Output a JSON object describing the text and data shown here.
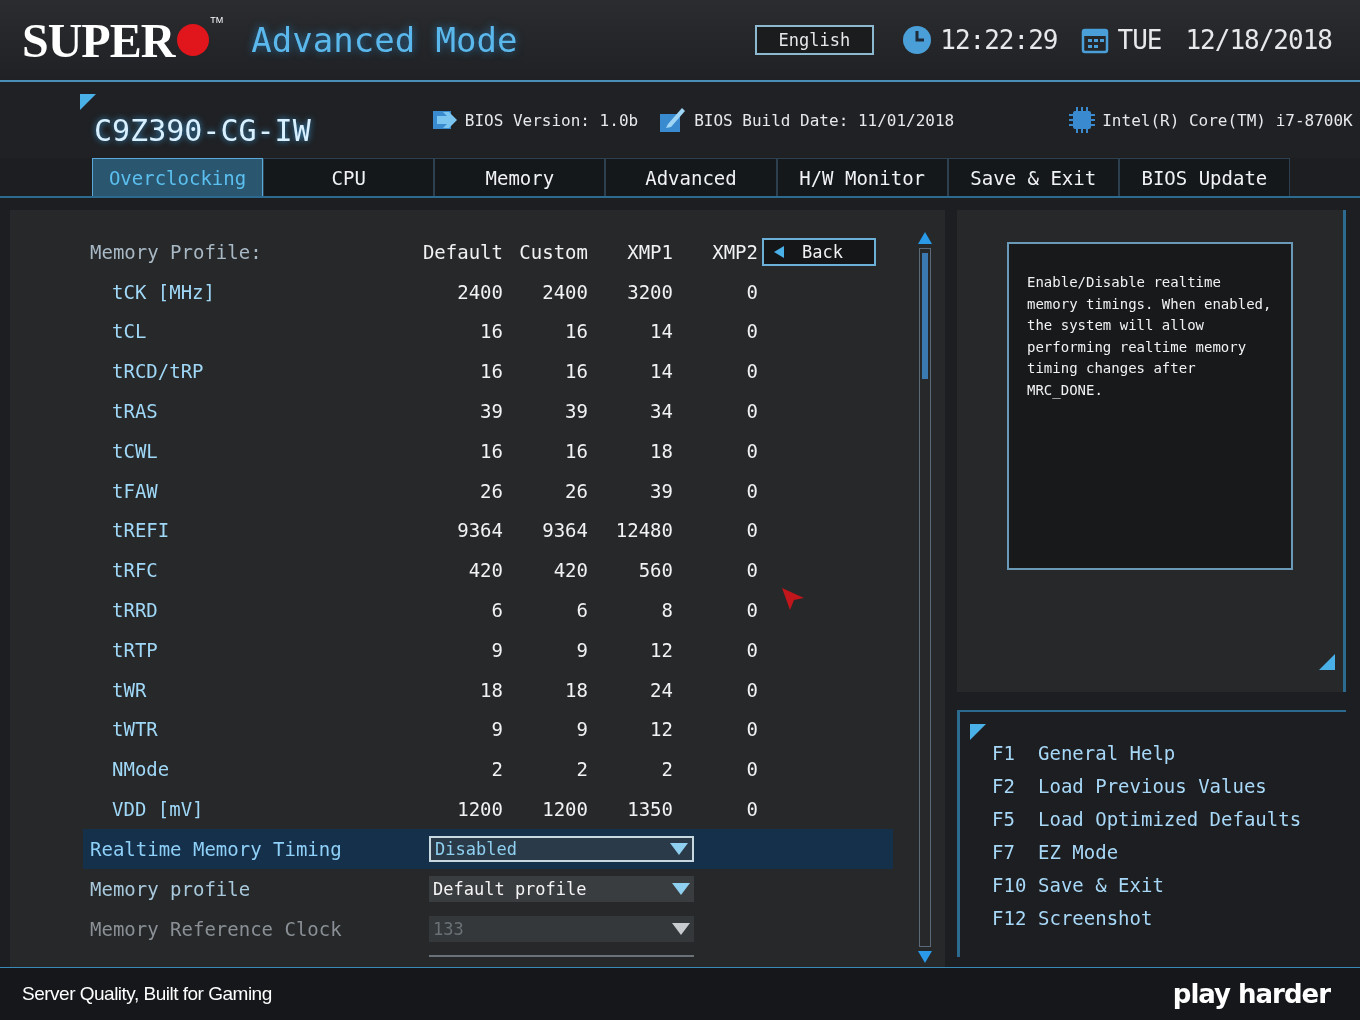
{
  "header": {
    "logo": "SUPER",
    "trademark": "TM",
    "mode_title": "Advanced Mode",
    "language": "English",
    "time": "12:22:29",
    "day": "TUE",
    "date": "12/18/2018"
  },
  "info_bar": {
    "board": "C9Z390-CG-IW",
    "bios_version": "BIOS Version: 1.0b",
    "build_date": "BIOS Build Date: 11/01/2018",
    "cpu": "Intel(R) Core(TM) i7-8700K"
  },
  "tabs": [
    {
      "label": "Overclocking",
      "selected": true
    },
    {
      "label": "CPU",
      "selected": false
    },
    {
      "label": "Memory",
      "selected": false
    },
    {
      "label": "Advanced",
      "selected": false
    },
    {
      "label": "H/W Monitor",
      "selected": false
    },
    {
      "label": "Save & Exit",
      "selected": false
    },
    {
      "label": "BIOS Update",
      "selected": false
    }
  ],
  "memory_table": {
    "columns": [
      "Memory Profile:",
      "Default",
      "Custom",
      "XMP1",
      "XMP2"
    ],
    "back_button": "Back",
    "rows": [
      {
        "label": "tCK [MHz]",
        "values": [
          "2400",
          "2400",
          "3200",
          "0"
        ]
      },
      {
        "label": "tCL",
        "values": [
          "16",
          "16",
          "14",
          "0"
        ]
      },
      {
        "label": "tRCD/tRP",
        "values": [
          "16",
          "16",
          "14",
          "0"
        ]
      },
      {
        "label": "tRAS",
        "values": [
          "39",
          "39",
          "34",
          "0"
        ]
      },
      {
        "label": "tCWL",
        "values": [
          "16",
          "16",
          "18",
          "0"
        ]
      },
      {
        "label": "tFAW",
        "values": [
          "26",
          "26",
          "39",
          "0"
        ]
      },
      {
        "label": "tREFI",
        "values": [
          "9364",
          "9364",
          "12480",
          "0"
        ]
      },
      {
        "label": "tRFC",
        "values": [
          "420",
          "420",
          "560",
          "0"
        ]
      },
      {
        "label": "tRRD",
        "values": [
          "6",
          "6",
          "8",
          "0"
        ]
      },
      {
        "label": "tRTP",
        "values": [
          "9",
          "9",
          "12",
          "0"
        ]
      },
      {
        "label": "tWR",
        "values": [
          "18",
          "18",
          "24",
          "0"
        ]
      },
      {
        "label": "tWTR",
        "values": [
          "9",
          "9",
          "12",
          "0"
        ]
      },
      {
        "label": "NMode",
        "values": [
          "2",
          "2",
          "2",
          "0"
        ]
      },
      {
        "label": "VDD [mV]",
        "values": [
          "1200",
          "1200",
          "1350",
          "0"
        ]
      }
    ]
  },
  "settings": [
    {
      "label": "Realtime Memory Timing",
      "value": "Disabled",
      "selected": true,
      "disabled": false
    },
    {
      "label": "Memory profile",
      "value": "Default profile",
      "selected": false,
      "disabled": false
    },
    {
      "label": "Memory Reference Clock",
      "value": "133",
      "selected": false,
      "disabled": true
    }
  ],
  "help_text": "Enable/Disable realtime memory timings. When enabled, the system will allow performing realtime memory timing changes after MRC_DONE.",
  "hotkeys": [
    {
      "key": "F1",
      "action": "General Help"
    },
    {
      "key": "F2",
      "action": "Load Previous Values"
    },
    {
      "key": "F5",
      "action": "Load Optimized Defaults"
    },
    {
      "key": "F7",
      "action": "EZ Mode"
    },
    {
      "key": "F10",
      "action": "Save & Exit"
    },
    {
      "key": "F12",
      "action": "Screenshot"
    }
  ],
  "footer": {
    "tagline": "Server Quality, Built for Gaming",
    "brand": "play harder"
  }
}
